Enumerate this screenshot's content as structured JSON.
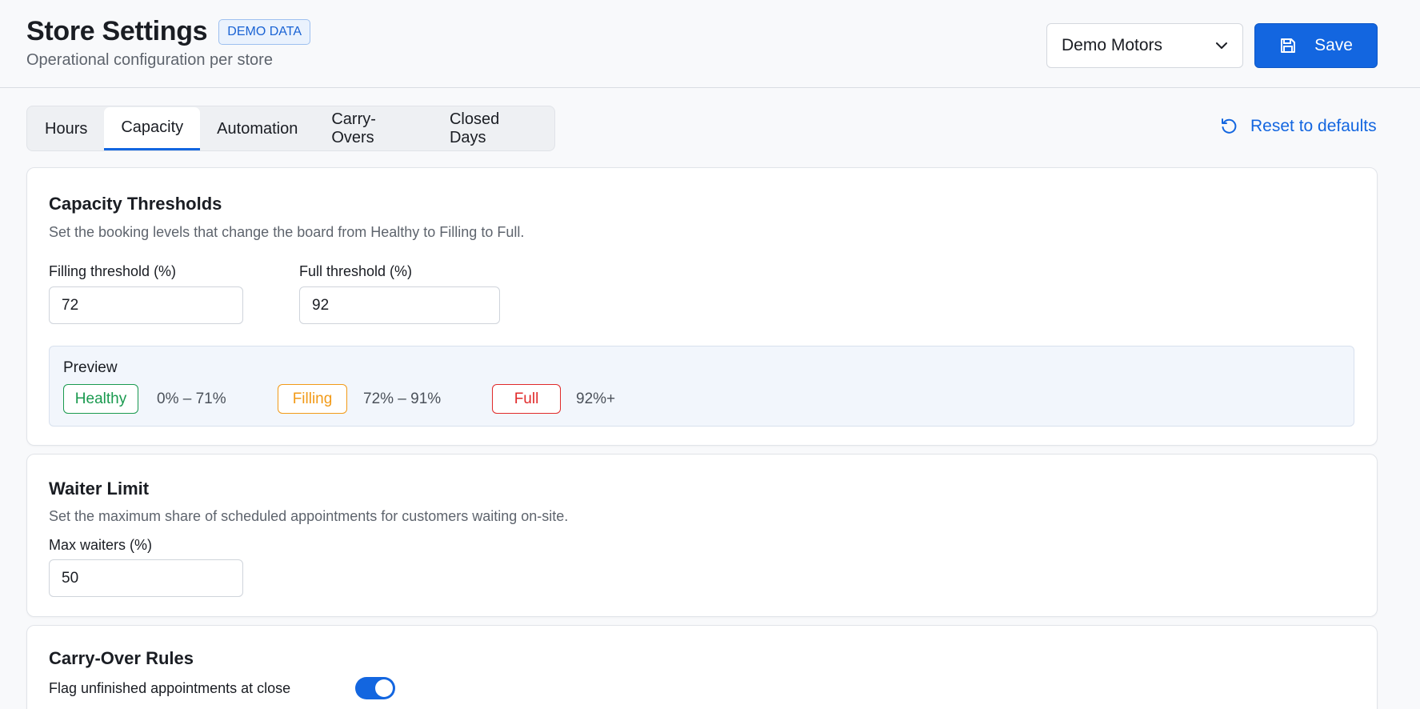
{
  "header": {
    "title": "Store Settings",
    "badge": "DEMO DATA",
    "subtitle": "Operational configuration per store",
    "store_select": {
      "value": "Demo Motors"
    },
    "save_label": "Save"
  },
  "tabs": [
    {
      "label": "Hours",
      "active": false
    },
    {
      "label": "Capacity",
      "active": true
    },
    {
      "label": "Automation",
      "active": false
    },
    {
      "label": "Carry-Overs",
      "active": false
    },
    {
      "label": "Closed Days",
      "active": false
    }
  ],
  "reset_label": "Reset to defaults",
  "capacity": {
    "title": "Capacity Thresholds",
    "description": "Set the booking levels that change the board from Healthy to Filling to Full.",
    "filling_label": "Filling threshold (%)",
    "filling_value": "72",
    "full_label": "Full threshold (%)",
    "full_value": "92",
    "preview": {
      "label": "Preview",
      "items": [
        {
          "status": "Healthy",
          "range": "0% – 71%",
          "color": "#1a9a4f"
        },
        {
          "status": "Filling",
          "range": "72% – 91%",
          "color": "#f29a17"
        },
        {
          "status": "Full",
          "range": "92%+",
          "color": "#e02a2a"
        }
      ]
    }
  },
  "waiter": {
    "title": "Waiter Limit",
    "description": "Set the maximum share of scheduled appointments for customers waiting on-site.",
    "max_label": "Max waiters (%)",
    "max_value": "50"
  },
  "carryover": {
    "title": "Carry-Over Rules",
    "flag_label": "Flag unfinished appointments at close",
    "flag_enabled": true
  },
  "colors": {
    "accent": "#1366e0"
  }
}
